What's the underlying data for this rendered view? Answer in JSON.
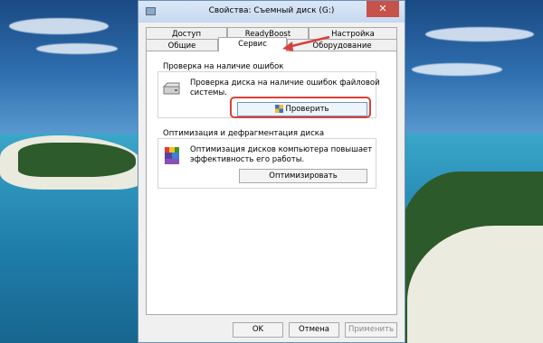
{
  "window": {
    "title": "Свойства: Съемный диск (G:)",
    "close_symbol": "✕"
  },
  "tabs_row1": [
    {
      "label": "Доступ"
    },
    {
      "label": "ReadyBoost"
    },
    {
      "label": "Настройка"
    }
  ],
  "tabs_row2": [
    {
      "label": "Общие"
    },
    {
      "label": "Сервис",
      "active": true
    },
    {
      "label": "Оборудование"
    }
  ],
  "error_check": {
    "title": "Проверка на наличие ошибок",
    "description_line1": "Проверка диска на наличие ошибок файловой",
    "description_line2": "системы.",
    "button_label": "Проверить",
    "icon": "drive-icon"
  },
  "optimize": {
    "title": "Оптимизация и дефрагментация диска",
    "description_line1": "Оптимизация дисков компьютера повышает",
    "description_line2": "эффективность его работы.",
    "button_label": "Оптимизировать",
    "icon": "defrag-icon"
  },
  "footer": {
    "ok_label": "OK",
    "cancel_label": "Отмена",
    "apply_label": "Применить"
  },
  "colors": {
    "highlight": "#d8413a",
    "arrow": "#d8413a",
    "close_button": "#c7524a"
  }
}
